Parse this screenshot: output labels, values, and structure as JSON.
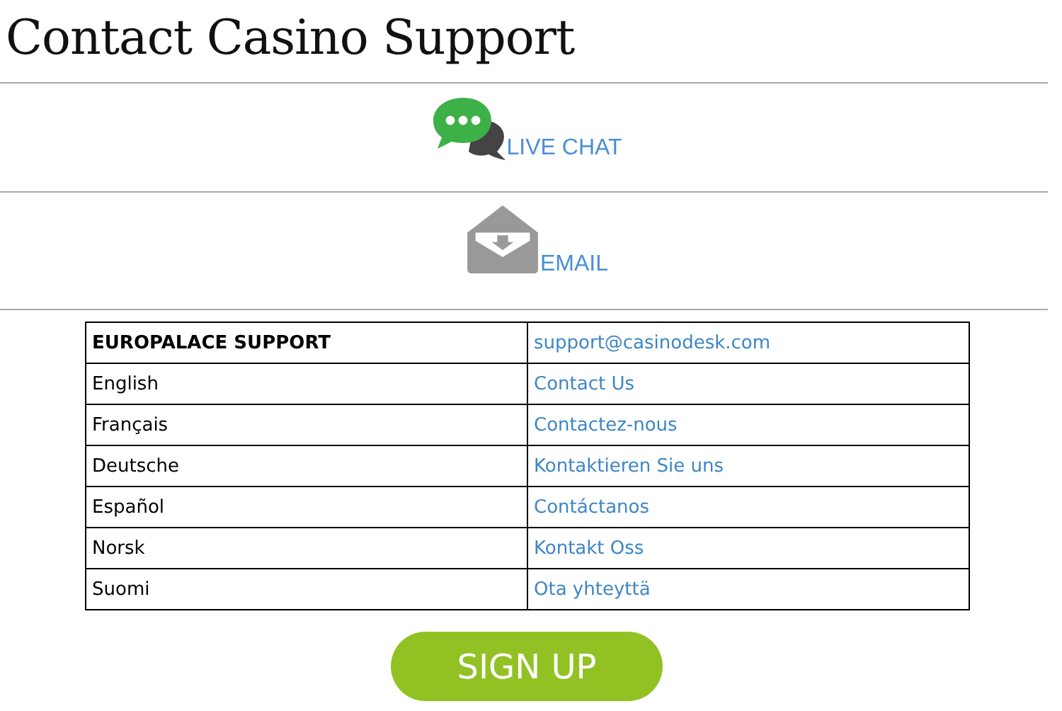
{
  "title": "Contact Casino Support",
  "contact_options": [
    {
      "kind": "chat",
      "label": "LIVE CHAT"
    },
    {
      "kind": "email",
      "label": "EMAIL"
    }
  ],
  "table": {
    "header": {
      "name": "EUROPALACE SUPPORT",
      "link": "support@casinodesk.com"
    },
    "rows": [
      {
        "language": "English",
        "link": "Contact Us"
      },
      {
        "language": "Français",
        "link": "Contactez-nous"
      },
      {
        "language": "Deutsche",
        "link": "Kontaktieren Sie uns"
      },
      {
        "language": "Español",
        "link": "Contáctanos"
      },
      {
        "language": "Norsk",
        "link": "Kontakt Oss"
      },
      {
        "language": "Suomi",
        "link": "Ota yhteyttä"
      }
    ]
  },
  "button": "SIGN UP"
}
